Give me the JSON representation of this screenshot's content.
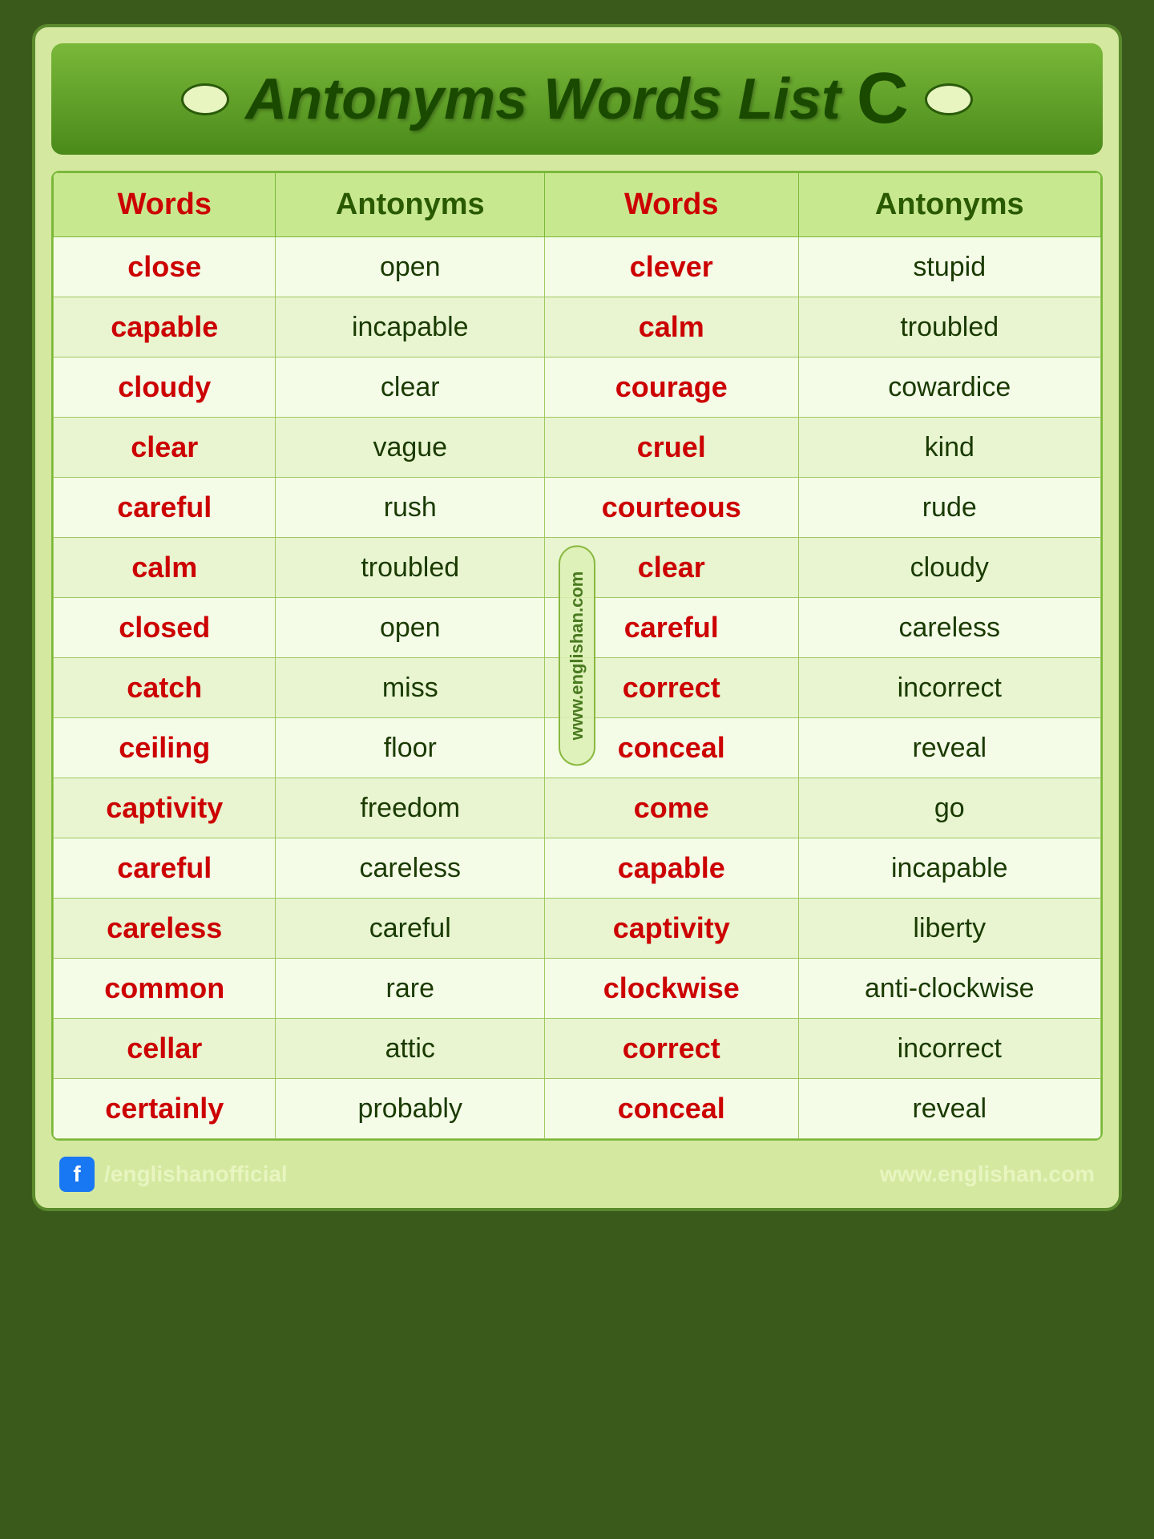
{
  "title": {
    "text": "Antonyms Words  List",
    "letter": "C"
  },
  "table": {
    "headers": [
      "Words",
      "Antonyms",
      "Words",
      "Antonyms"
    ],
    "rows": [
      [
        "close",
        "open",
        "clever",
        "stupid"
      ],
      [
        "capable",
        "incapable",
        "calm",
        "troubled"
      ],
      [
        "cloudy",
        "clear",
        "courage",
        "cowardice"
      ],
      [
        "clear",
        "vague",
        "cruel",
        "kind"
      ],
      [
        "careful",
        "rush",
        "courteous",
        "rude"
      ],
      [
        "calm",
        "troubled",
        "clear",
        "cloudy"
      ],
      [
        "closed",
        "open",
        "careful",
        "careless"
      ],
      [
        "catch",
        "miss",
        "correct",
        "incorrect"
      ],
      [
        "ceiling",
        "floor",
        "conceal",
        "reveal"
      ],
      [
        "captivity",
        "freedom",
        "come",
        "go"
      ],
      [
        "careful",
        "careless",
        "capable",
        "incapable"
      ],
      [
        "careless",
        "careful",
        "captivity",
        "liberty"
      ],
      [
        "common",
        "rare",
        "clockwise",
        "anti-clockwise"
      ],
      [
        "cellar",
        "attic",
        "correct",
        "incorrect"
      ],
      [
        "certainly",
        "probably",
        "conceal",
        "reveal"
      ]
    ]
  },
  "watermark": "www.englishan.com",
  "footer": {
    "social": "/englishanofficial",
    "website": "www.englishan.com"
  }
}
